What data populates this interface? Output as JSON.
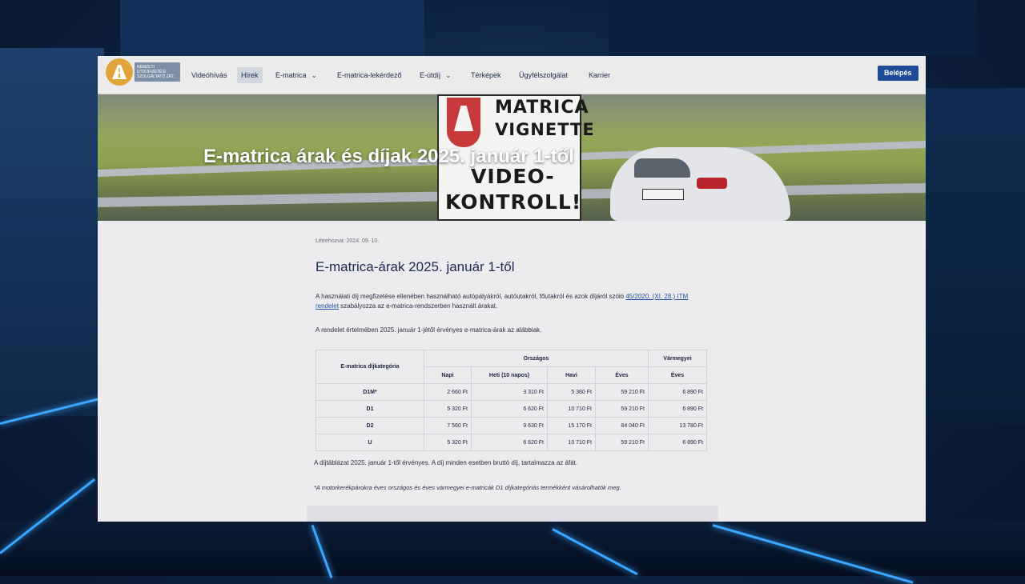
{
  "nav": {
    "logo_text": "NEMZETI ÚTDÍJFIZETÉSI SZOLGÁLTATÓ ZRT.",
    "items": [
      {
        "label": "Videóhívás",
        "has_dropdown": false
      },
      {
        "label": "Hírek",
        "has_dropdown": false,
        "active": true
      },
      {
        "label": "E-matrica",
        "has_dropdown": true
      },
      {
        "label": "E-matrica-lekérdező",
        "has_dropdown": false
      },
      {
        "label": "E-útdíj",
        "has_dropdown": true
      },
      {
        "label": "Térképek",
        "has_dropdown": false
      },
      {
        "label": "Ügyfélszolgálat",
        "has_dropdown": false
      },
      {
        "label": "Karrier",
        "has_dropdown": false
      }
    ],
    "login_label": "Belépés",
    "chevron": "⌄"
  },
  "hero": {
    "title": "E-matrica árak és díjak 2025. január 1-től",
    "sign_lines": [
      "MATRICA",
      "VIGNETTE",
      "VIDEO-",
      "KONTROLL!"
    ]
  },
  "article": {
    "created": "Létrehozva: 2024. 09. 10.",
    "heading": "E-matrica-árak 2025. január 1-től",
    "para1_before": "A használati díj megfizetése ellenében használható autópályákról, autóutakról, főutakról és azok díjáról szóló ",
    "para1_link": "45/2020. (XI. 28.) ITM rendelet",
    "para1_after": " szabályozza az e-matrica-rendszerben használt árakat.",
    "para2": "A rendelet értelmében 2025. január 1-jétől érvényes e-matrica-árak az alábbiak."
  },
  "table": {
    "col_category": "E-matrica díjkategória",
    "group_national": "Országos",
    "group_county": "Vármegyei",
    "sub_headers": [
      "Napi",
      "Heti (10 napos)",
      "Havi",
      "Éves",
      "Éves"
    ],
    "rows": [
      {
        "cat": "D1M*",
        "values": [
          "2 660 Ft",
          "3 310 Ft",
          "5 360 Ft",
          "59 210 Ft",
          "6 890 Ft"
        ]
      },
      {
        "cat": "D1",
        "values": [
          "5 320 Ft",
          "6 620 Ft",
          "10 710 Ft",
          "59 210 Ft",
          "6 890 Ft"
        ]
      },
      {
        "cat": "D2",
        "values": [
          "7 560 Ft",
          "9 630 Ft",
          "15 170 Ft",
          "84 040 Ft",
          "13 780 Ft"
        ]
      },
      {
        "cat": "U",
        "values": [
          "5 320 Ft",
          "6 620 Ft",
          "10 710 Ft",
          "59 210 Ft",
          "6 890 Ft"
        ]
      }
    ]
  },
  "footer": {
    "note1": "A díjtáblázat 2025. január 1-től érvényes. A díj minden esetben bruttó díj, tartalmazza az áfát.",
    "note2": "*A motorkerékpárokra éves országos és éves vármegyei e-matricák D1 díjkategóriás termékként vásárolhatók meg."
  }
}
